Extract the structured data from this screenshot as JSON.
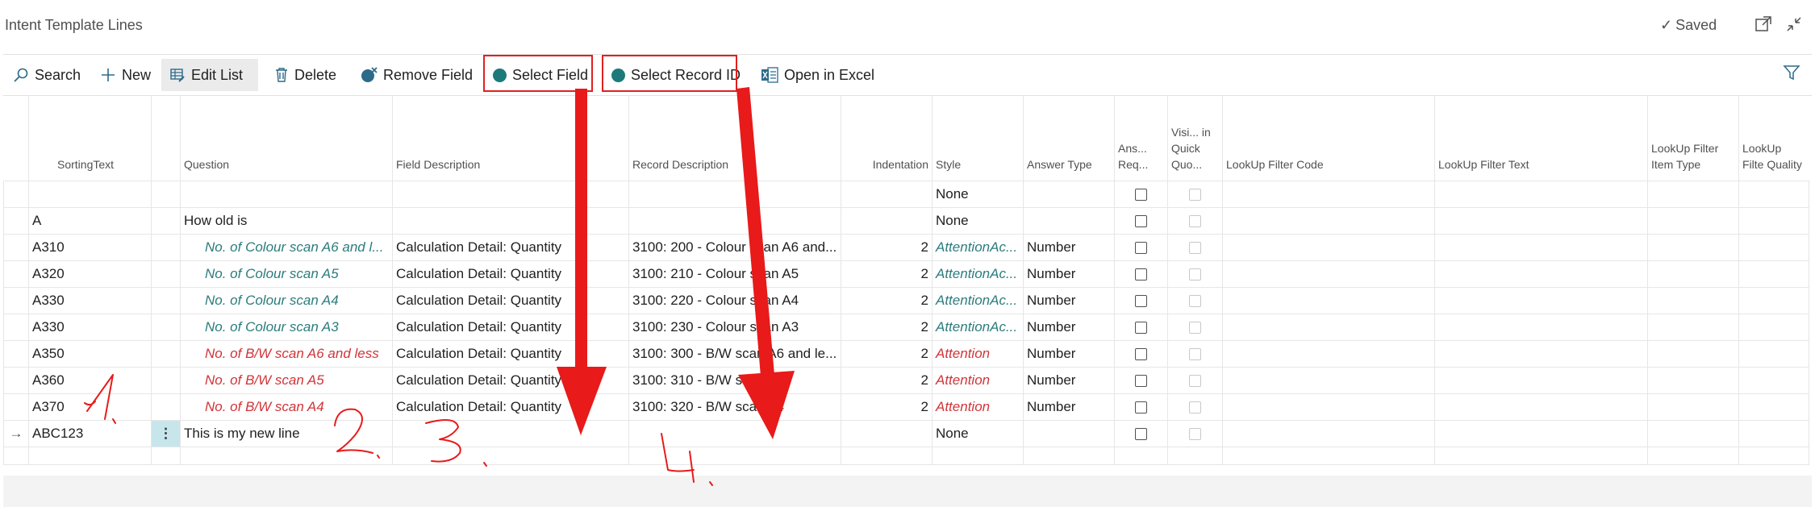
{
  "header": {
    "title": "Intent Template Lines",
    "saved_label": "Saved"
  },
  "actions": {
    "search": "Search",
    "new": "New",
    "edit_list": "Edit List",
    "delete": "Delete",
    "remove_field": "Remove Field",
    "select_field": "Select Field",
    "select_record_id": "Select Record ID",
    "open_in_excel": "Open in Excel"
  },
  "columns": {
    "sorting_text": "SortingText",
    "question": "Question",
    "field_description": "Field Description",
    "record_description": "Record Description",
    "indentation": "Indentation",
    "style": "Style",
    "answer_type": "Answer Type",
    "ans_req": "Ans... Req...",
    "visible_in_quick_quote": "Visi... in Quick Quo...",
    "lookup_filter_code": "LookUp Filter Code",
    "lookup_filter_text": "LookUp Filter Text",
    "lookup_filter_item_type": "LookUp Filter Item Type",
    "lookup_filter_quality": "LookUp Filte Quality"
  },
  "rows": [
    {
      "sorting": "",
      "question": "",
      "field": "",
      "record": "",
      "indent": "",
      "style": "None",
      "answer": ""
    },
    {
      "sorting": "A",
      "question": "How old is",
      "field": "",
      "record": "",
      "indent": "",
      "style": "None",
      "answer": ""
    },
    {
      "sorting": "A310",
      "question": "No. of Colour scan A6 and l...",
      "field": "Calculation Detail: Quantity",
      "record": "3100: 200 - Colour scan A6 and...",
      "indent": "2",
      "style": "AttentionAc...",
      "answer": "Number"
    },
    {
      "sorting": "A320",
      "question": "No. of Colour scan A5",
      "field": "Calculation Detail: Quantity",
      "record": "3100: 210 - Colour scan A5",
      "indent": "2",
      "style": "AttentionAc...",
      "answer": "Number"
    },
    {
      "sorting": "A330",
      "question": "No. of Colour scan A4",
      "field": "Calculation Detail: Quantity",
      "record": "3100: 220 - Colour scan A4",
      "indent": "2",
      "style": "AttentionAc...",
      "answer": "Number"
    },
    {
      "sorting": "A330",
      "question": "No. of Colour scan A3",
      "field": "Calculation Detail: Quantity",
      "record": "3100: 230 - Colour scan A3",
      "indent": "2",
      "style": "AttentionAc...",
      "answer": "Number"
    },
    {
      "sorting": "A350",
      "question": "No. of B/W scan A6 and less",
      "field": "Calculation Detail: Quantity",
      "record": "3100: 300 - B/W scan A6 and le...",
      "indent": "2",
      "style": "Attention",
      "answer": "Number"
    },
    {
      "sorting": "A360",
      "question": "No. of B/W scan A5",
      "field": "Calculation Detail: Quantity",
      "record": "3100: 310 - B/W scan A5",
      "indent": "2",
      "style": "Attention",
      "answer": "Number"
    },
    {
      "sorting": "A370",
      "question": "No. of B/W scan A4",
      "field": "Calculation Detail: Quantity",
      "record": "3100: 320 - B/W scan A4",
      "indent": "2",
      "style": "Attention",
      "answer": "Number"
    },
    {
      "sorting": "ABC123",
      "question": "This is my new line",
      "field": "",
      "record": "",
      "indent": "",
      "style": "None",
      "answer": ""
    }
  ],
  "colors": {
    "accent_teal": "#1e7a7a",
    "attention_accent": "#2c7c7c",
    "attention": "#d13438",
    "annotation_red": "#e02020"
  }
}
